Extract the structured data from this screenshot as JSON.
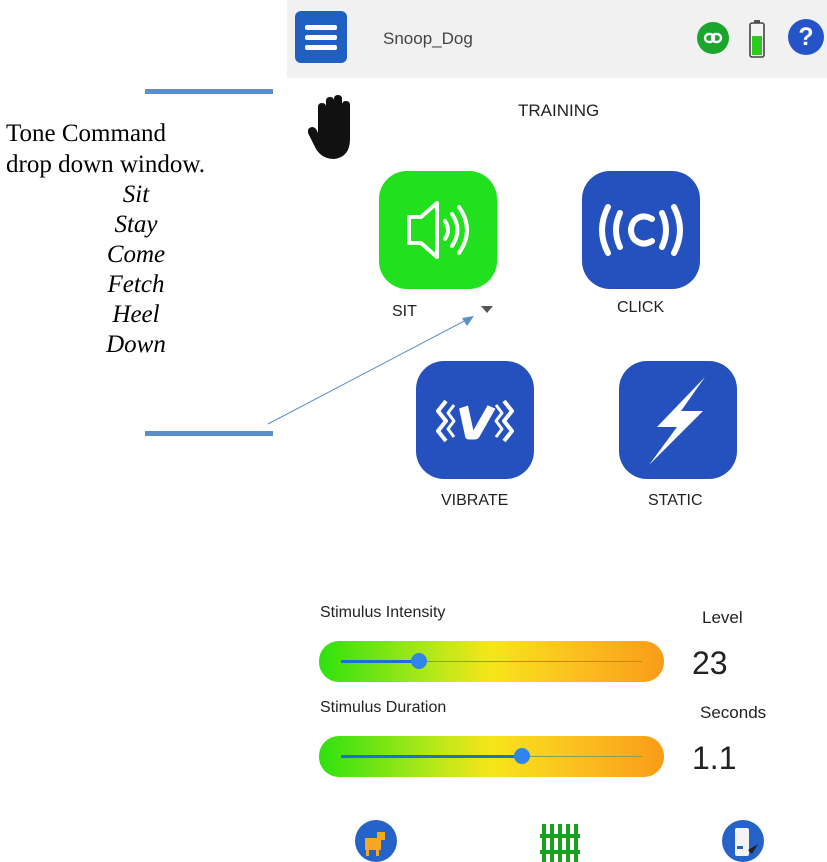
{
  "annotation": {
    "heading_line1": "Tone Command",
    "heading_line2": "drop down window.",
    "options": [
      "Sit",
      "Stay",
      "Come",
      "Fetch",
      "Heel",
      "Down"
    ]
  },
  "header": {
    "title": "Snoop_Dog",
    "icons": [
      "menu-icon",
      "link-icon",
      "battery-icon",
      "help-icon"
    ],
    "help_glyph": "?"
  },
  "training": {
    "title": "TRAINING",
    "buttons": [
      {
        "label": "SIT",
        "icon": "speaker-icon",
        "color": "#21e11e"
      },
      {
        "label": "CLICK",
        "icon": "click-icon",
        "color": "#2451bd"
      },
      {
        "label": "VIBRATE",
        "icon": "vibrate-icon",
        "color": "#2451bd"
      },
      {
        "label": "STATIC",
        "icon": "lightning-icon",
        "color": "#2451bd"
      }
    ]
  },
  "stimulus": {
    "intensity_label": "Stimulus Intensity",
    "intensity_unit_label": "Level",
    "intensity_value": "23",
    "intensity_fraction": 0.26,
    "duration_label": "Stimulus Duration",
    "duration_unit_label": "Seconds",
    "duration_value": "1.1",
    "duration_fraction": 0.6
  },
  "bottom_nav": [
    "dog-icon",
    "fence-icon",
    "device-icon"
  ],
  "colors": {
    "accent_blue": "#2451bd",
    "active_green": "#21e11e",
    "annotation_rule": "#5b8fc9"
  }
}
